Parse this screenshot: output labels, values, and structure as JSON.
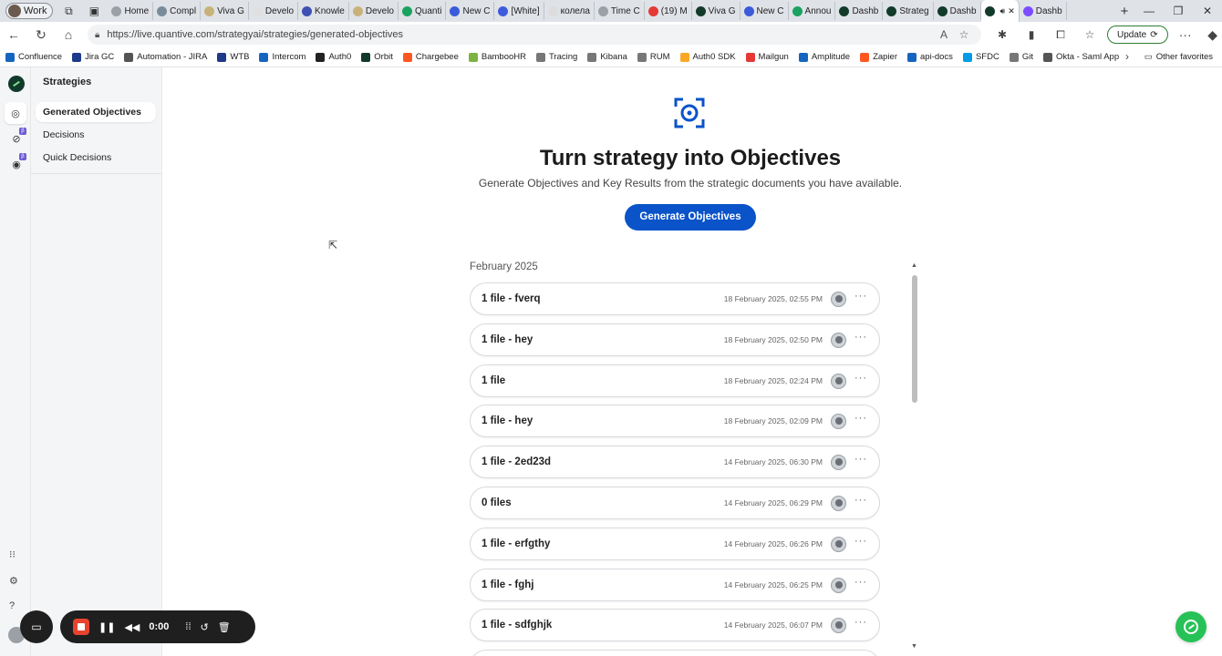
{
  "browser": {
    "profile": "Work",
    "tabs": [
      {
        "label": "Home",
        "color": "#9aa0a6"
      },
      {
        "label": "Compl",
        "color": "#7a8c99"
      },
      {
        "label": "Viva G",
        "color": "#c9b27a"
      },
      {
        "label": "Develo",
        "color": "#e0e0e0"
      },
      {
        "label": "Knowle",
        "color": "#3f51b5"
      },
      {
        "label": "Develo",
        "color": "#c9b27a"
      },
      {
        "label": "Quanti",
        "color": "#1aa260"
      },
      {
        "label": "New C",
        "color": "#3b5bdb"
      },
      {
        "label": "[White]",
        "color": "#3b5bdb"
      },
      {
        "label": "колела",
        "color": "#dddddd"
      },
      {
        "label": "Time C",
        "color": "#9aa0a6"
      },
      {
        "label": "(19) M",
        "color": "#e53935"
      },
      {
        "label": "Viva G",
        "color": "#123a2a"
      },
      {
        "label": "New C",
        "color": "#3b5bdb"
      },
      {
        "label": "Annou",
        "color": "#1aa260"
      },
      {
        "label": "Dashb",
        "color": "#123a2a"
      },
      {
        "label": "Strateg",
        "color": "#123a2a"
      },
      {
        "label": "Dashb",
        "color": "#123a2a"
      },
      {
        "label": "",
        "color": "#123a2a",
        "active": true
      },
      {
        "label": "Dashb",
        "color": "#7c4dff"
      }
    ],
    "url": "https://live.quantive.com/strategyai/strategies/generated-objectives",
    "update_label": "Update",
    "bookmarks": [
      {
        "label": "Confluence",
        "color": "#1565c0"
      },
      {
        "label": "Jira GC",
        "color": "#1e3a8a"
      },
      {
        "label": "Automation - JIRA",
        "color": "#555555"
      },
      {
        "label": "WTB",
        "color": "#1e3a8a"
      },
      {
        "label": "Intercom",
        "color": "#1565c0"
      },
      {
        "label": "Auth0",
        "color": "#222222"
      },
      {
        "label": "Orbit",
        "color": "#123a2a"
      },
      {
        "label": "Chargebee",
        "color": "#ff5722"
      },
      {
        "label": "BambooHR",
        "color": "#7cb342"
      },
      {
        "label": "Tracing",
        "color": "#777777"
      },
      {
        "label": "Kibana",
        "color": "#777777"
      },
      {
        "label": "RUM",
        "color": "#777777"
      },
      {
        "label": "Auth0 SDK",
        "color": "#f9a825"
      },
      {
        "label": "Mailgun",
        "color": "#e53935"
      },
      {
        "label": "Amplitude",
        "color": "#1565c0"
      },
      {
        "label": "Zapier",
        "color": "#ff5722"
      },
      {
        "label": "api-docs",
        "color": "#1565c0"
      },
      {
        "label": "SFDC",
        "color": "#039be5"
      },
      {
        "label": "Git",
        "color": "#777777"
      },
      {
        "label": "Okta - Saml App",
        "color": "#555555"
      }
    ],
    "other_favorites": "Other favorites"
  },
  "sidebar": {
    "title": "Strategies",
    "items": [
      {
        "label": "Generated Objectives",
        "active": true
      },
      {
        "label": "Decisions"
      },
      {
        "label": "Quick Decisions"
      }
    ],
    "beta_badge": "β"
  },
  "main": {
    "title": "Turn strategy into Objectives",
    "subtitle": "Generate Objectives and Key Results from the strategic documents you have available.",
    "generate_button": "Generate Objectives",
    "month_label": "February 2025",
    "rows": [
      {
        "name": "1 file - fverq",
        "date": "18 February 2025, 02:55 PM"
      },
      {
        "name": "1 file - hey",
        "date": "18 February 2025, 02:50 PM"
      },
      {
        "name": "1 file",
        "date": "18 February 2025, 02:24 PM"
      },
      {
        "name": "1 file - hey",
        "date": "18 February 2025, 02:09 PM"
      },
      {
        "name": "1 file - 2ed23d",
        "date": "14 February 2025, 06:30 PM"
      },
      {
        "name": "0 files",
        "date": "14 February 2025, 06:29 PM"
      },
      {
        "name": "1 file - erfgthy",
        "date": "14 February 2025, 06:26 PM"
      },
      {
        "name": "1 file - fghj",
        "date": "14 February 2025, 06:25 PM"
      },
      {
        "name": "1 file - sdfghjk",
        "date": "14 February 2025, 06:07 PM"
      },
      {
        "name": "",
        "date": ""
      }
    ],
    "more_glyph": "···"
  },
  "recorder": {
    "time": "0:00"
  }
}
